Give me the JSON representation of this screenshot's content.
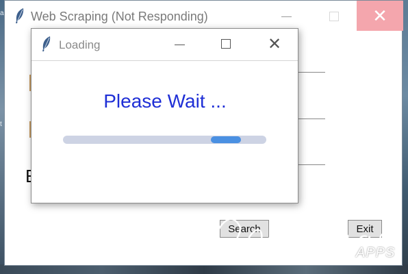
{
  "main_window": {
    "title": "Web Scraping (Not Responding)",
    "big_letter": "E",
    "search_button_label": "Search",
    "exit_button_label": "Exit",
    "close_symbol": "✕"
  },
  "dialog": {
    "title": "Loading",
    "message": "Please Wait ...",
    "close_symbol": "✕",
    "progress_position": 0.86,
    "colors": {
      "message": "#1f2fd6",
      "progress_track": "#cdd3e4",
      "progress_fill": "#4a90e2"
    }
  },
  "desktop": {
    "edge_text_top": "a",
    "edge_text_mid": "t"
  },
  "watermark": {
    "brand": "Icecream",
    "sub": "APPS"
  }
}
